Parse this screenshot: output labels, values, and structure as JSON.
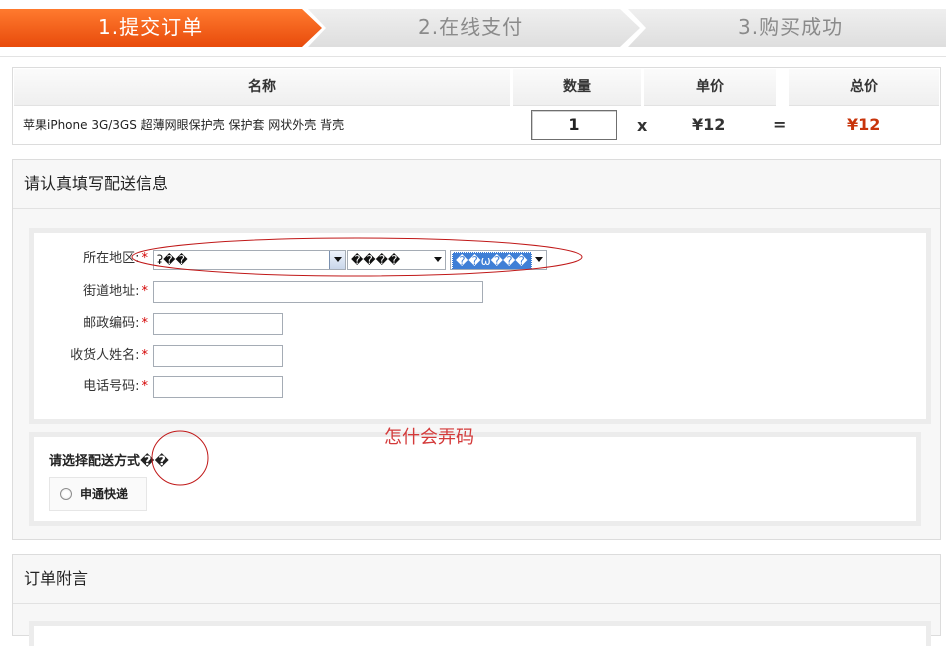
{
  "steps": [
    {
      "label": "1.提交订单",
      "state": "active"
    },
    {
      "label": "2.在线支付",
      "state": "inactive"
    },
    {
      "label": "3.购买成功",
      "state": "inactive"
    }
  ],
  "colors": {
    "step_active": "#f05a14",
    "step_inactive": "#e3e3e3",
    "price_total": "#c8340b",
    "required_mark": "#d40000",
    "annotation": "#d43a3a"
  },
  "order": {
    "headers": {
      "name": "名称",
      "qty": "数量",
      "unit": "单价",
      "total": "总价"
    },
    "item": {
      "name": "苹果iPhone 3G/3GS 超薄网眼保护壳 保护套 网状外壳 背壳",
      "qty": "1",
      "times": "x",
      "unit_price": "¥12",
      "equals": "=",
      "total_price": "¥12"
    }
  },
  "delivery": {
    "title": "请认真填写配送信息",
    "fields": {
      "region_label": "所在地区:",
      "street_label": "街道地址:",
      "zip_label": "邮政编码:",
      "receiver_label": "收货人姓名:",
      "phone_label": "电话号码:",
      "required": "*"
    },
    "region_selects": {
      "province": "ʡ��",
      "city": "����",
      "district": "��ѡ���"
    },
    "shipping": {
      "title": "请选择配送方式��",
      "option": "申通快递"
    },
    "annotation": "怎什会弄码"
  },
  "remark": {
    "title": "订单附言"
  }
}
